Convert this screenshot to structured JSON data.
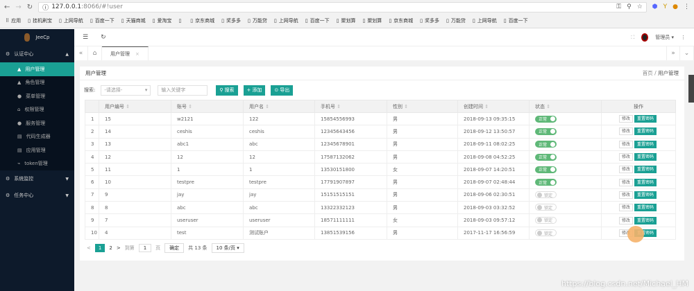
{
  "browser": {
    "url_host": "127.0.0.1",
    "url_rest": ":8066/#!user",
    "bookmarks": [
      "应用",
      "挂机刷宝",
      "上网导航",
      "百度一下",
      "天猫商城",
      "爱淘宝",
      "",
      "京东商城",
      "奖多多",
      "万能贷",
      "上网导航",
      "百度一下",
      "聚划算",
      "聚划算",
      "京东商城",
      "奖多多",
      "万能贷",
      "上网导航",
      "百度一下"
    ]
  },
  "sidebar": {
    "logo": "JeeCp",
    "groups": [
      {
        "label": "认证中心",
        "items": [
          "用户管理",
          "角色管理",
          "菜单管理",
          "权限管理",
          "服务管理",
          "代码生成器",
          "应用管理",
          "token管理"
        ]
      },
      {
        "label": "系统监控"
      },
      {
        "label": "任务中心"
      }
    ]
  },
  "header": {
    "user": "管理员"
  },
  "tab": {
    "label": "用户管理"
  },
  "card": {
    "title": "用户管理",
    "breadcrumb_home": "首页",
    "breadcrumb_sep": "/",
    "breadcrumb_current": "用户管理"
  },
  "search": {
    "label": "搜索:",
    "select_placeholder": "-请选择-",
    "input_placeholder": "输入关键字",
    "search_btn": "搜索",
    "add_btn": "添加",
    "export_btn": "导出"
  },
  "table": {
    "headers": [
      "",
      "用户编号",
      "账号",
      "用户名",
      "手机号",
      "性别",
      "创建时间",
      "状态",
      "操作"
    ],
    "rows": [
      [
        "1",
        "15",
        "w2121",
        "122",
        "15854556993",
        "男",
        "2018-09-13 09:35:15",
        "正常"
      ],
      [
        "2",
        "14",
        "ceshis",
        "ceshis",
        "12345643456",
        "男",
        "2018-09-12 13:50:57",
        "正常"
      ],
      [
        "3",
        "13",
        "abc1",
        "abc",
        "12345678901",
        "男",
        "2018-09-11 08:02:25",
        "正常"
      ],
      [
        "4",
        "12",
        "12",
        "12",
        "17587132062",
        "男",
        "2018-09-08 04:52:25",
        "正常"
      ],
      [
        "5",
        "11",
        "1",
        "1",
        "13530151800",
        "女",
        "2018-09-07 14:20:51",
        "正常"
      ],
      [
        "6",
        "10",
        "testpre",
        "testpre",
        "17791907897",
        "男",
        "2018-09-07 02:48:44",
        "正常"
      ],
      [
        "7",
        "9",
        "jay",
        "jay",
        "15151515151",
        "男",
        "2018-09-06 02:30:51",
        "锁定"
      ],
      [
        "8",
        "8",
        "abc",
        "abc",
        "13322332123",
        "男",
        "2018-09-03 03:32:52",
        "锁定"
      ],
      [
        "9",
        "7",
        "useruser",
        "useruser",
        "18571111111",
        "女",
        "2018-09-03 09:57:12",
        "锁定"
      ],
      [
        "10",
        "4",
        "test",
        "测试账户",
        "13851539156",
        "男",
        "2017-11-17 16:56:59",
        "锁定"
      ]
    ],
    "edit_label": "修改",
    "reset_label": "重置密码"
  },
  "pagination": {
    "prev": "<",
    "pages": [
      "1",
      "2"
    ],
    "next": ">",
    "goto": "到第",
    "goto_value": "1",
    "page_unit": "页",
    "confirm": "确定",
    "total": "共 13 条",
    "page_size": "10 条/页"
  },
  "watermark": "https://blog.csdn.net/Michael_HM"
}
